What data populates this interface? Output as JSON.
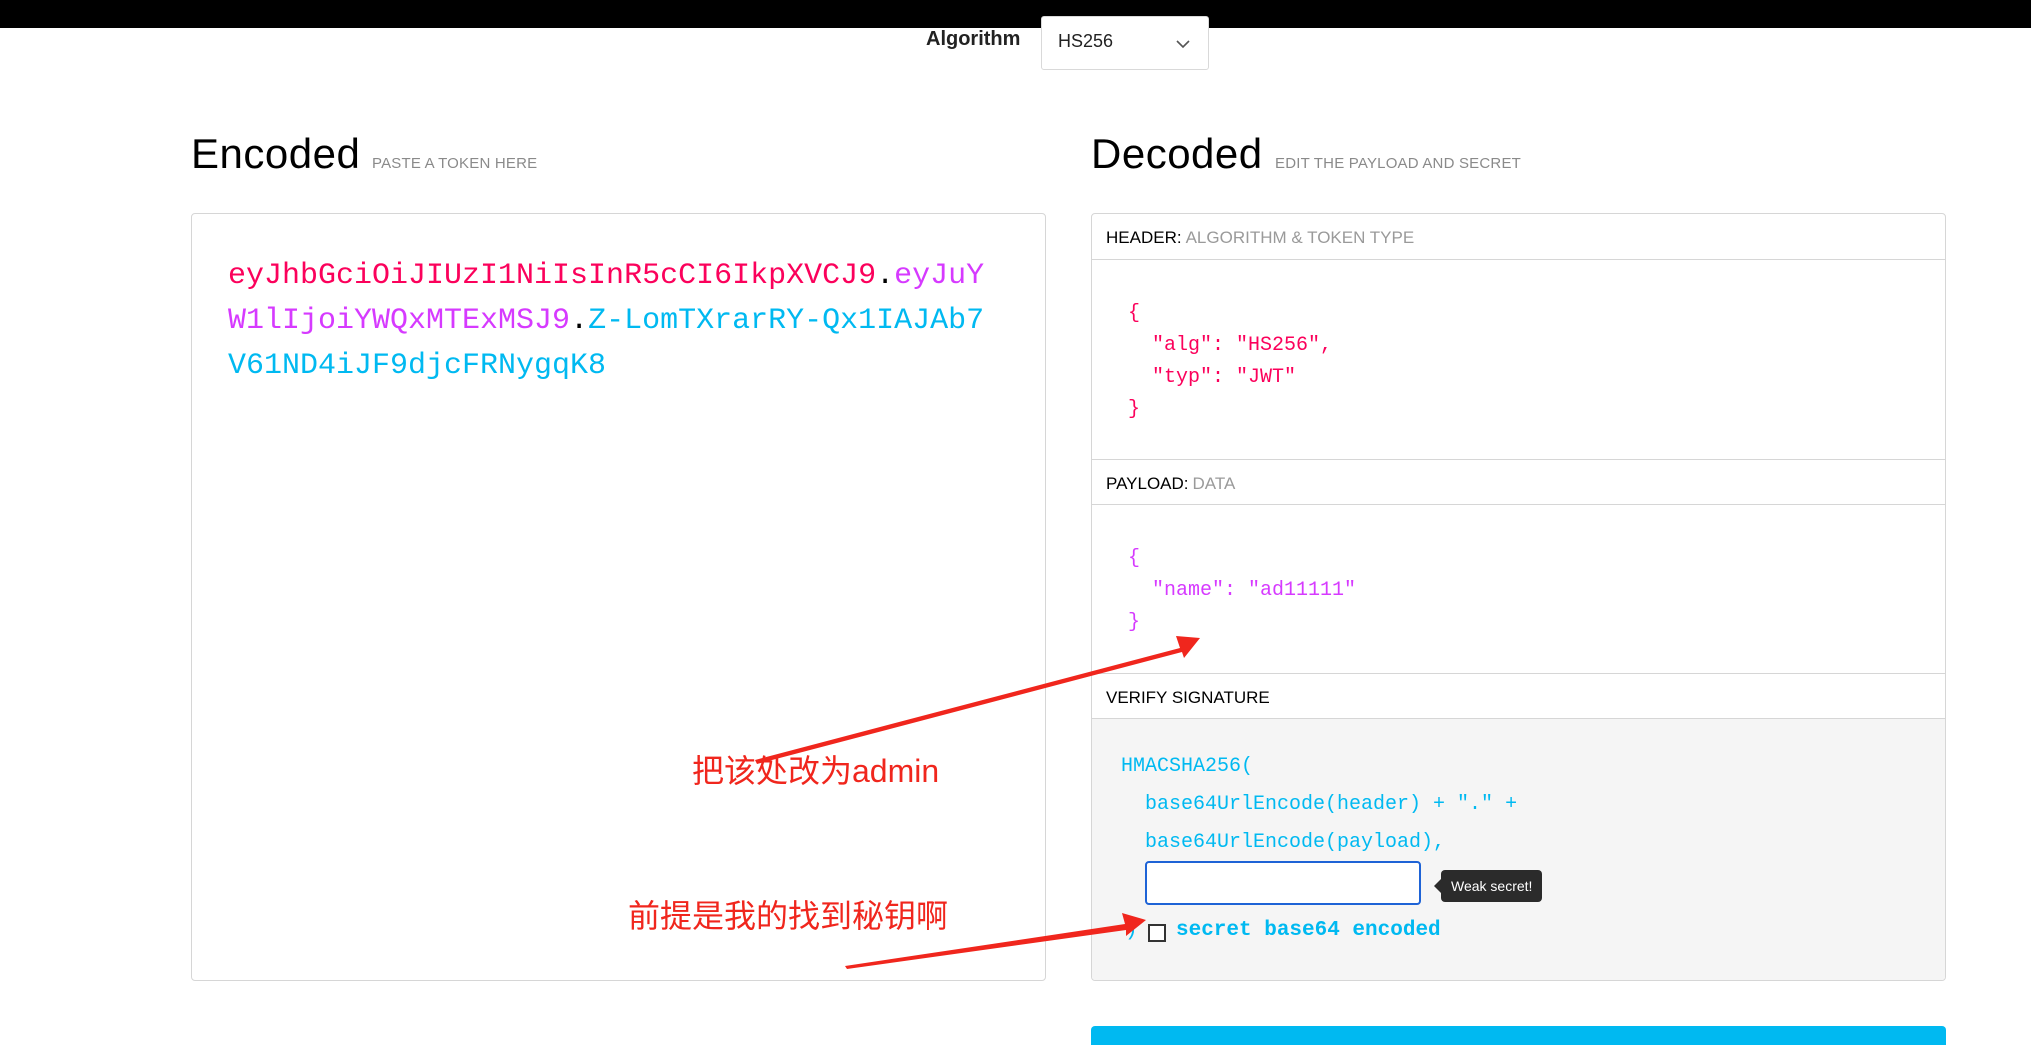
{
  "algorithm": {
    "label": "Algorithm",
    "selected": "HS256"
  },
  "encoded": {
    "title": "Encoded",
    "subtitle": "PASTE A TOKEN HERE",
    "token_header": "eyJhbGciOiJIUzI1NiIsInR5cCI6IkpXVCJ9",
    "token_payload": "eyJuYW1lIjoiYWQxMTExMSJ9",
    "token_signature": "Z-LomTXrarRY-Qx1IAJAb7V61ND4iJF9djcFRNygqK8",
    "dot": "."
  },
  "decoded": {
    "title": "Decoded",
    "subtitle": "EDIT THE PAYLOAD AND SECRET",
    "header_section": {
      "label": "HEADER:",
      "sub": "ALGORITHM & TOKEN TYPE"
    },
    "header_json": {
      "open": "{",
      "line1": "  \"alg\": \"HS256\",",
      "line2": "  \"typ\": \"JWT\"",
      "close": "}"
    },
    "payload_section": {
      "label": "PAYLOAD:",
      "sub": "DATA"
    },
    "payload_json": {
      "open": "{",
      "line1": "  \"name\": \"ad11111\"",
      "close": "}"
    },
    "verify_section": {
      "label": "VERIFY SIGNATURE"
    },
    "verify": {
      "fn": "HMACSHA256(",
      "line1": "  base64UrlEncode(header) + \".\" +",
      "line2": "  base64UrlEncode(payload),",
      "close": ")",
      "secret_value": "",
      "tooltip": "Weak secret!",
      "checkbox_label": "secret base64 encoded"
    }
  },
  "annotations": {
    "note1": "把该处改为admin",
    "note2": "前提是我的找到秘钥啊"
  },
  "colors": {
    "header": "#fb015b",
    "payload": "#d63aff",
    "signature": "#00b9f1",
    "annotation": "#f0261d"
  }
}
